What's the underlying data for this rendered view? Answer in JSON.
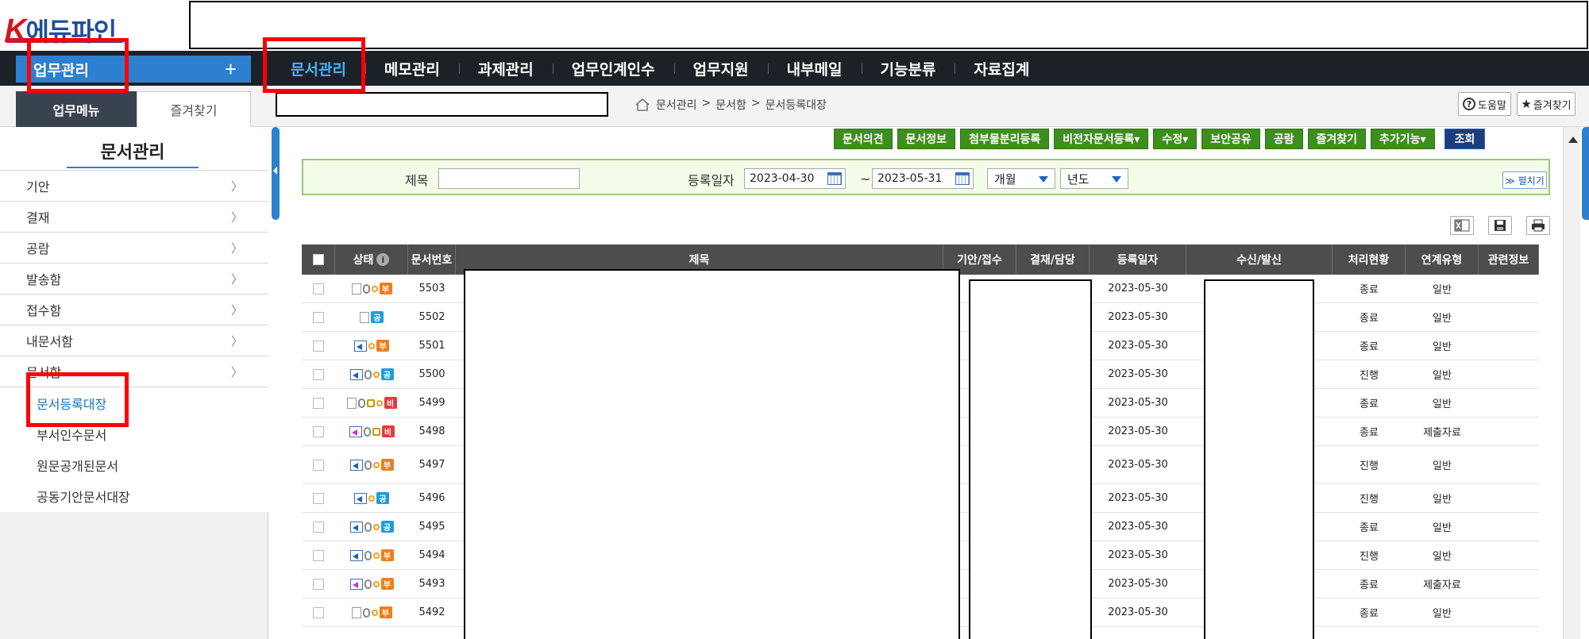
{
  "logo": {
    "k": "K",
    "rest": "에듀파인"
  },
  "nav": {
    "work_button": "업무관리",
    "plus": "+",
    "items": [
      "문서관리",
      "메모관리",
      "과제관리",
      "업무인계인수",
      "업무지원",
      "내부메일",
      "기능분류",
      "자료집계"
    ]
  },
  "tabs": {
    "menu": "업무메뉴",
    "favorites": "즐겨찾기"
  },
  "breadcrumb": [
    "문서관리",
    ">",
    "문서함",
    ">",
    "문서등록대장"
  ],
  "header_buttons": {
    "help": "도움말",
    "fav": "즐겨찾기"
  },
  "sidebar": {
    "title": "문서관리",
    "items": [
      "기안",
      "결재",
      "공람",
      "발송함",
      "접수함",
      "내문서함",
      "문서함"
    ],
    "sub_items": [
      "문서등록대장",
      "부서인수문서",
      "원문공개된문서",
      "공동기안문서대장"
    ]
  },
  "toolbar": {
    "buttons": [
      "문서의견",
      "문서정보",
      "첨부물분리등록",
      "비전자문서등록▾",
      "수정▾",
      "보안공유",
      "공람",
      "즐겨찾기",
      "추가기능▾"
    ],
    "search": "조회"
  },
  "filter": {
    "title_label": "제목",
    "date_label": "등록일자",
    "date_from": "2023-04-30",
    "tilde": "~",
    "date_to": "2023-05-31",
    "period": "개월",
    "year": "년도",
    "unfold": "≫ 펼치기"
  },
  "table": {
    "headers": [
      "",
      "상태",
      "문서번호",
      "제목",
      "기안/접수",
      "결재/담당",
      "등록일자",
      "수신/발신",
      "처리현황",
      "연계유형",
      "관련정보"
    ],
    "rows": [
      {
        "no": "5503",
        "date": "2023-05-30",
        "status": "종료",
        "type": "일반",
        "icons": [
          "doc",
          "clip",
          "dot",
          "부"
        ]
      },
      {
        "no": "5502",
        "date": "2023-05-30",
        "status": "종료",
        "type": "일반",
        "icons": [
          "doc",
          "공"
        ]
      },
      {
        "no": "5501",
        "date": "2023-05-30",
        "status": "종료",
        "type": "일반",
        "icons": [
          "send",
          "dot",
          "부"
        ]
      },
      {
        "no": "5500",
        "date": "2023-05-30",
        "status": "진행",
        "type": "일반",
        "icons": [
          "send",
          "clip",
          "dot",
          "공"
        ]
      },
      {
        "no": "5499",
        "date": "2023-05-30",
        "status": "종료",
        "type": "일반",
        "icons": [
          "doc",
          "clip",
          "lock",
          "dot",
          "비"
        ]
      },
      {
        "no": "5498",
        "date": "2023-05-30",
        "status": "종료",
        "type": "제출자료",
        "icons": [
          "send-pink",
          "clip",
          "lock",
          "비"
        ]
      },
      {
        "no": "5497",
        "date": "2023-05-30",
        "status": "진행",
        "type": "일반",
        "icons": [
          "send",
          "clip",
          "dot",
          "부"
        ]
      },
      {
        "no": "5496",
        "date": "2023-05-30",
        "status": "진행",
        "type": "일반",
        "icons": [
          "send",
          "dot",
          "공"
        ]
      },
      {
        "no": "5495",
        "date": "2023-05-30",
        "status": "종료",
        "type": "일반",
        "icons": [
          "send",
          "clip",
          "dot",
          "공"
        ]
      },
      {
        "no": "5494",
        "date": "2023-05-30",
        "status": "진행",
        "type": "일반",
        "icons": [
          "send",
          "clip",
          "dot",
          "부"
        ]
      },
      {
        "no": "5493",
        "date": "2023-05-30",
        "status": "종료",
        "type": "제출자료",
        "icons": [
          "send-pink",
          "clip",
          "dot",
          "부"
        ]
      },
      {
        "no": "5492",
        "date": "2023-05-30",
        "status": "종료",
        "type": "일반",
        "icons": [
          "doc",
          "clip",
          "dot",
          "부"
        ]
      }
    ]
  },
  "colors": {
    "nav_bg": "#1c2128",
    "accent": "#2d7fd0",
    "green_btn": "#3d8f1c",
    "highlight": "#ff0000"
  }
}
